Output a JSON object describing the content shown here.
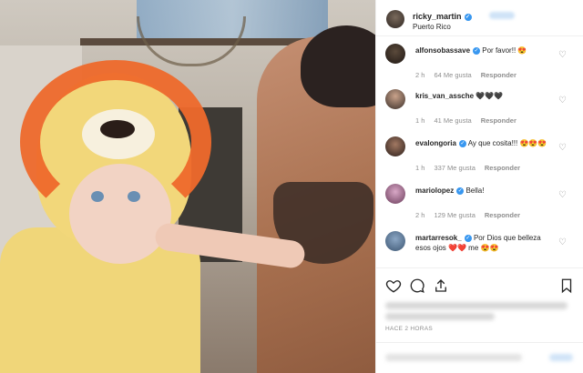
{
  "post": {
    "username": "ricky_martin",
    "location": "Puerto Rico"
  },
  "comments": [
    {
      "username": "alfonsobassave",
      "text": "Por favor!! 😍",
      "time": "2 h",
      "likes": "64 Me gusta",
      "reply": "Responder"
    },
    {
      "username": "kris_van_assche",
      "text": "🖤🖤🖤",
      "time": "1 h",
      "likes": "41 Me gusta",
      "reply": "Responder"
    },
    {
      "username": "evalongoria",
      "text": "Ay que cosita!!! 😍😍😍",
      "time": "1 h",
      "likes": "337 Me gusta",
      "reply": "Responder"
    },
    {
      "username": "mariolopez",
      "text": "Bella!",
      "time": "2 h",
      "likes": "129 Me gusta",
      "reply": "Responder"
    },
    {
      "username": "martarresok_",
      "text": "Por Dios que belleza esos ojos ❤️❤️ me 😍😍",
      "time": "",
      "likes": "",
      "reply": ""
    }
  ],
  "timestamp": "HACE 2 HORAS",
  "colors": {
    "verified": "#3897f0",
    "meta": "#8e8e8e",
    "text": "#262626"
  },
  "icons": [
    "heart-icon",
    "comment-icon",
    "share-icon",
    "bookmark-icon"
  ]
}
